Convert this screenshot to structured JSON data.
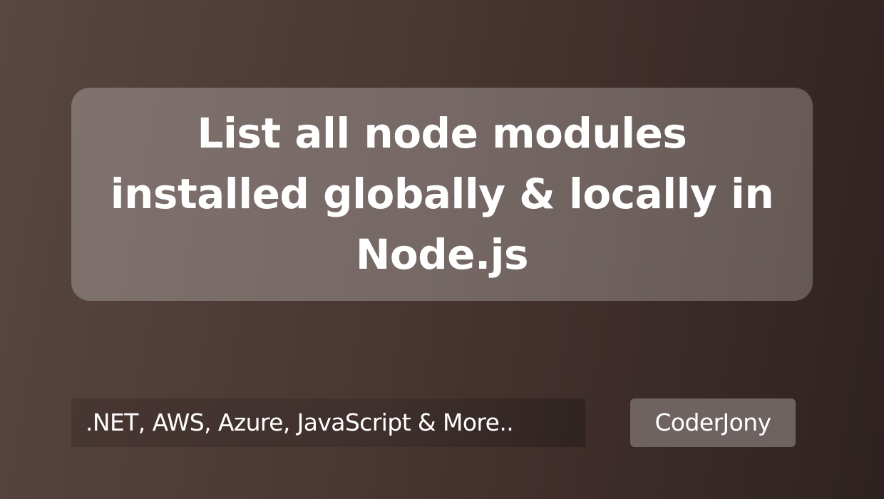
{
  "title": {
    "lines": [
      "List all node modules",
      "installed globally & locally in",
      "Node.js"
    ]
  },
  "tagline": ".NET, AWS, Azure, JavaScript & More..",
  "brand": "CoderJony",
  "colors": {
    "background_start": "#584640",
    "background_end": "#2e2220",
    "card": "#7a6d69",
    "badge": "#6e6360",
    "text": "#ffffff"
  }
}
